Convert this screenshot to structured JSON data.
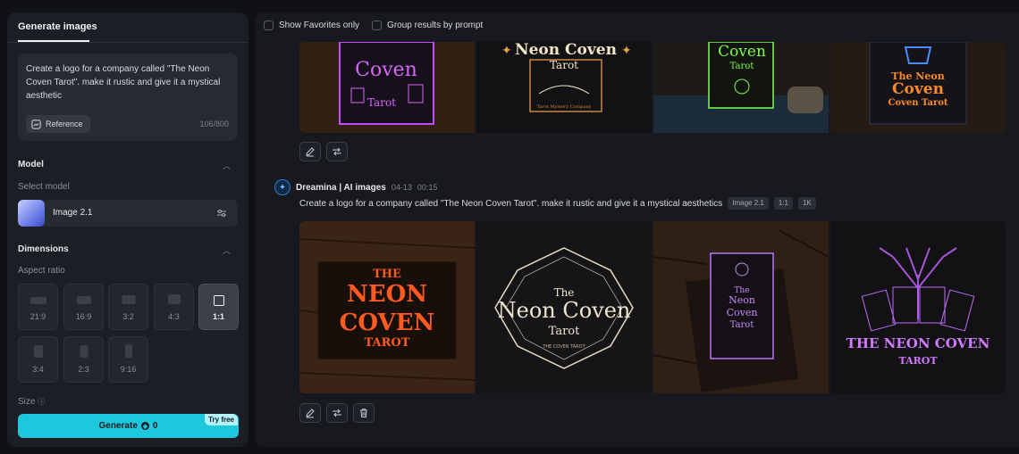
{
  "sidebar": {
    "tab": "Generate images",
    "prompt": "Create a logo for a company called \"The Neon Coven Tarot\". make it rustic and give it a mystical aesthetic",
    "reference_label": "Reference",
    "char_count": "106/800",
    "model_section": "Model",
    "select_model_label": "Select model",
    "model_name": "Image 2.1",
    "dimensions_section": "Dimensions",
    "aspect_ratio_label": "Aspect ratio",
    "ratios": [
      "21:9",
      "16:9",
      "3:2",
      "4:3",
      "1:1",
      "3:4",
      "2:3",
      "9:16"
    ],
    "selected_ratio": "1:1",
    "size_label": "Size",
    "generate_label": "Generate",
    "generate_cost": "0",
    "try_free": "Try free"
  },
  "toolbar": {
    "favorites": "Show Favorites only",
    "group": "Group results by prompt"
  },
  "result": {
    "author": "Dreamina | AI images",
    "date": "04-13",
    "time": "00:15",
    "prompt": "Create a logo for a company called \"The Neon Coven Tarot\". make it rustic and give it a mystical aesthetics",
    "tags": [
      "Image 2.1",
      "1:1",
      "1K"
    ]
  },
  "images_top": {
    "img1": [
      "Coven",
      "Tarot"
    ],
    "img2": [
      "Neon Coven",
      "Tarot",
      "Tarot Mystery Company"
    ],
    "img3": [
      "Coven",
      "Tarot"
    ],
    "img4": [
      "The Neon",
      "Coven",
      "Coven Tarot"
    ]
  },
  "images_bottom": {
    "img1": [
      "THE",
      "NEON",
      "COVEN",
      "TAROT"
    ],
    "img2": [
      "The",
      "Neon Coven",
      "Tarot",
      "THE COVEN TAROT"
    ],
    "img3": [
      "The",
      "Neon",
      "Coven",
      "Tarot"
    ],
    "img4": [
      "THE NEON COVEN",
      "TAROT"
    ]
  }
}
